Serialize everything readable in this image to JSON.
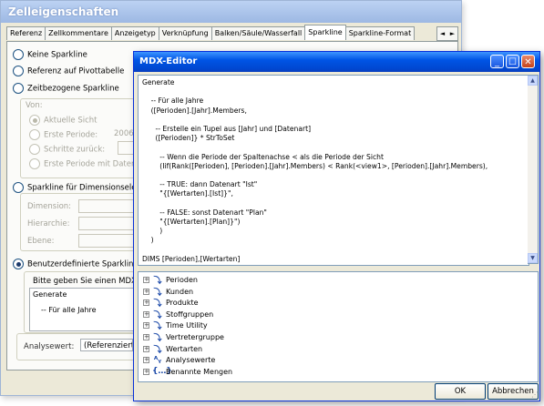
{
  "back_window": {
    "title": "Zelleigenschaften",
    "tabs": [
      "Referenz",
      "Zellkommentare",
      "Anzeigetyp",
      "Verknüpfung",
      "Balken/Säule/Wasserfall",
      "Sparkline",
      "Sparkline-Format"
    ],
    "active_tab": "Sparkline",
    "options": {
      "keine": "Keine Sparkline",
      "pivot": "Referenz auf Pivottabelle",
      "zeit": "Zeitbezogene Sparkline",
      "dimension": "Sparkline für Dimensionselem",
      "benutzer": "Benutzerdefinierte Sparkline"
    },
    "von_label": "Von:",
    "von_options": [
      "Aktuelle Sicht",
      "Erste Periode:",
      "Schritte zurück:",
      "Erste Periode mit Daten"
    ],
    "erste_periode_value": "2006",
    "dim_labels": [
      "Dimension:",
      "Hierarchie:",
      "Ebene:"
    ],
    "mdx_prompt": "Bitte geben Sie einen MDX-A",
    "mdx_preview": [
      "Generate",
      "-- Für alle Jahre"
    ],
    "analysewert_label": "Analysewert:",
    "analysewert_value": "(Referenzierte"
  },
  "editor": {
    "title": "MDX-Editor",
    "code_lines": [
      "Generate",
      "",
      "    -- Für alle Jahre",
      "    ([Perioden].[Jahr].Members,",
      "",
      "      -- Erstelle ein Tupel aus [Jahr] und [Datenart]",
      "      ([Perioden]} * StrToSet",
      "",
      "        -- Wenn die Periode der Spaltenachse < als die Periode der Sicht",
      "        (Iif(Rank([Perioden], [Perioden].[Jahr].Members) < Rank(<view1>, [Perioden].[Jahr].Members),",
      "",
      "        -- TRUE: dann Datenart \"Ist\"",
      "        \"{[Wertarten].[Ist]}\",",
      "",
      "        -- FALSE: sonst Datenart \"Plan\"",
      "        \"{[Wertarten].[Plan]}\")",
      "        )",
      "    )",
      "",
      "DIMS [Perioden],[Wertarten]"
    ],
    "tree": [
      {
        "label": "Perioden",
        "icon": "hierarchy-icon",
        "glyph": "⤵"
      },
      {
        "label": "Kunden",
        "icon": "hierarchy-icon",
        "glyph": "⤵"
      },
      {
        "label": "Produkte",
        "icon": "hierarchy-icon",
        "glyph": "⤵"
      },
      {
        "label": "Stoffgruppen",
        "icon": "hierarchy-icon",
        "glyph": "⤵"
      },
      {
        "label": "Time Utility",
        "icon": "hierarchy-icon",
        "glyph": "⤵"
      },
      {
        "label": "Vertretergruppe",
        "icon": "hierarchy-icon",
        "glyph": "⤵"
      },
      {
        "label": "Wertarten",
        "icon": "hierarchy-icon",
        "glyph": "⤵"
      },
      {
        "label": "Analysewerte",
        "icon": "measure-icon",
        "glyph": "ᴬᵧ"
      },
      {
        "label": "Benannte Mengen",
        "icon": "set-icon",
        "glyph": "{…}"
      }
    ],
    "ok_label": "OK",
    "cancel_label": "Abbrechen"
  }
}
